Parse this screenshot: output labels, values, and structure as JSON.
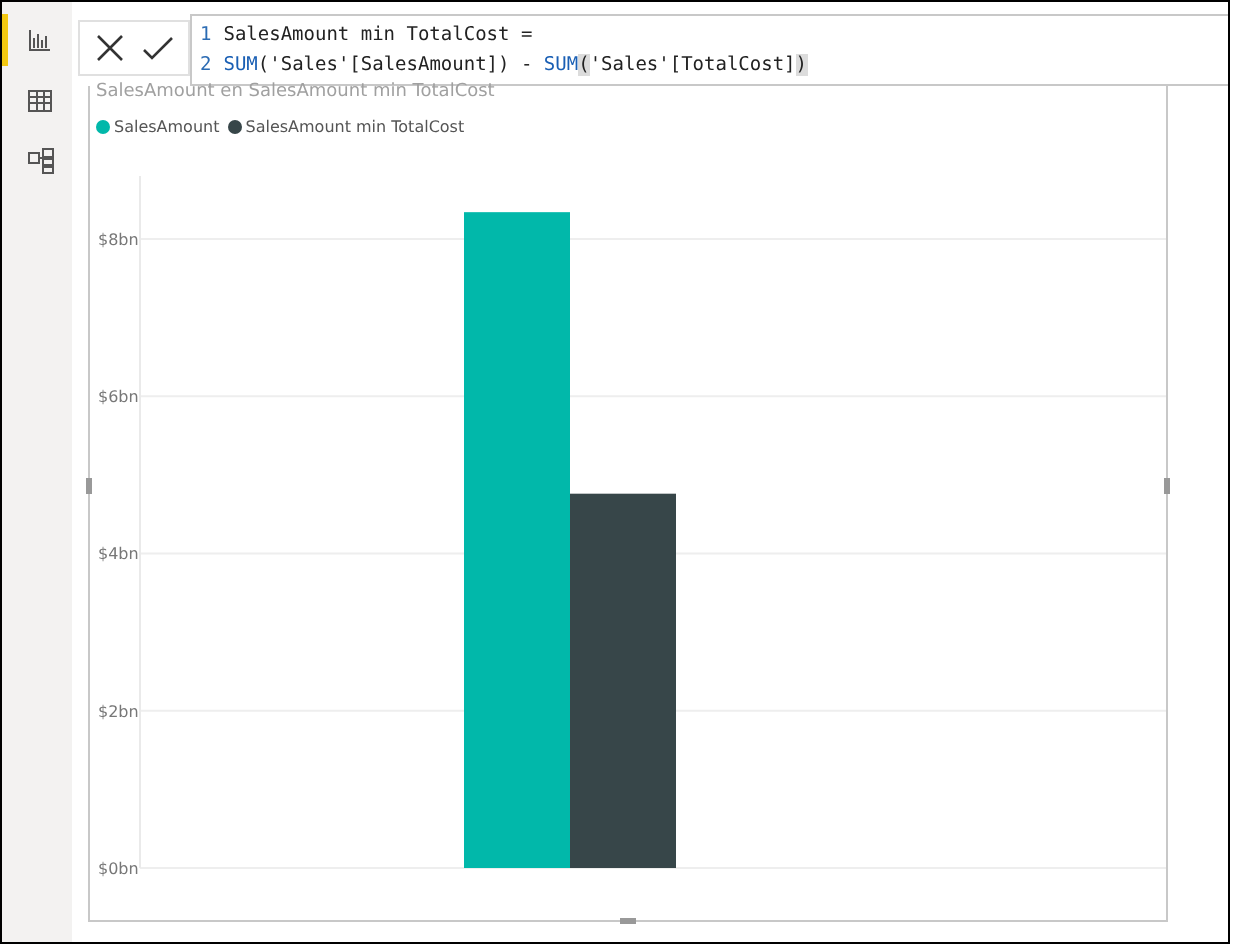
{
  "sidebar": {
    "items": [
      {
        "kind": "report",
        "selected": true
      },
      {
        "kind": "data",
        "selected": false
      },
      {
        "kind": "model",
        "selected": false
      }
    ]
  },
  "formula_bar": {
    "lines": [
      {
        "number": "1",
        "segments": [
          {
            "kind": "plain",
            "text": "SalesAmount min TotalCost ="
          }
        ]
      },
      {
        "number": "2",
        "segments": [
          {
            "kind": "function",
            "text": "SUM"
          },
          {
            "kind": "plain",
            "text": "('Sales'[SalesAmount]) - "
          },
          {
            "kind": "function",
            "text": "SUM"
          },
          {
            "kind": "bracket",
            "text": "("
          },
          {
            "kind": "plain",
            "text": "'Sales'[TotalCost]"
          },
          {
            "kind": "bracket",
            "text": ")"
          }
        ]
      }
    ]
  },
  "visual": {
    "title": "SalesAmount en SalesAmount min TotalCost",
    "chart_data": {
      "type": "bar",
      "grid": true,
      "series": [
        {
          "name": "SalesAmount",
          "color": "#01b8aa",
          "values": [
            8.34
          ]
        },
        {
          "name": "SalesAmount min TotalCost",
          "color": "#374649",
          "values": [
            4.76
          ]
        }
      ],
      "ylim": [
        0,
        8.8
      ],
      "yticks": [
        {
          "value": 0,
          "label": "$0bn"
        },
        {
          "value": 2,
          "label": "$2bn"
        },
        {
          "value": 4,
          "label": "$4bn"
        },
        {
          "value": 6,
          "label": "$6bn"
        },
        {
          "value": 8,
          "label": "$8bn"
        }
      ]
    }
  }
}
